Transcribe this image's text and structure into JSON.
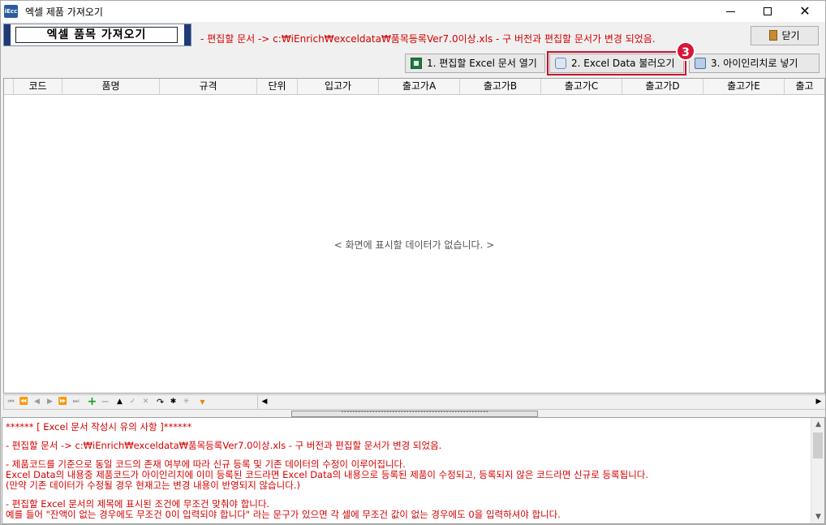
{
  "window": {
    "title": "엑셀 제품 가져오기",
    "app_icon_text": "iEcc",
    "minimize_label": "",
    "maximize_label": "",
    "close_glyph": "✕"
  },
  "header": {
    "heading": "엑셀 품목 가져오기",
    "note": "- 편집할 문서 -> c:₩iEnrich₩exceldata₩품목등록Ver7.0이상.xls - 구 버전과 편집할 문서가 변경 되었음.",
    "close_button": "닫기"
  },
  "toolbar": {
    "buttons": [
      {
        "label": "1. 편집할 Excel 문서 열기",
        "icon": "excel-icon"
      },
      {
        "label": "2. Excel Data 불러오기",
        "icon": "import-data-icon"
      },
      {
        "label": "3. 아이인리치로 넣기",
        "icon": "database-insert-icon"
      }
    ],
    "badge": "3",
    "highlight_color": "#c8102e"
  },
  "grid": {
    "columns": [
      "코드",
      "품명",
      "규격",
      "단위",
      "입고가",
      "출고가A",
      "출고가B",
      "출고가C",
      "출고가D",
      "출고가E",
      "출고"
    ],
    "empty_message": "< 화면에 표시할 데이터가 없습니다. >"
  },
  "navigator": {
    "buttons": [
      "⏮",
      "⏪",
      "◀",
      "▶",
      "⏩",
      "⏭",
      "+",
      "−",
      "▲",
      "✓",
      "✕",
      "↷",
      "✱",
      "✳",
      "▼"
    ],
    "scroll_left": "◀",
    "scroll_right": "▶",
    "splitter": "˅˅˅˅˅˅˅˅˅˅˅˅˅˅˅˅˅˅˅˅˅˅˅˅˅˅˅˅˅˅˅˅˅˅˅˅˅˅˅˅˅˅˅˅˅˅˅˅˅˅˅˅"
  },
  "notes": {
    "lines": [
      "****** [ Excel 문서 작성시 유의 사항 ]******",
      "- 편집할 문서 -> c:₩iEnrich₩exceldata₩품목등록Ver7.0이상.xls - 구 버전과 편집할 문서가 변경 되었음.",
      "- 제품코드를 기준으로 동일 코드의 존재 여부에 따라 신규 등록 및 기존 데이터의 수정이 이루어집니다.",
      " Excel Data의 내용중 제품코드가 아이인리치에 이미 등록된 코드라면 Excel Data의 내용으로 등록된 제품이 수정되고,  등록되지 않은 코드라면 신규로 등록됩니다.",
      "(만약 기존 데이터가 수정될 경우 현재고는 변경 내용이 반영되지 않습니다.)",
      "- 편집할 Excel 문서의 제목에 표시된 조건에 무조건 맞춰야 합니다.",
      "예를 들어 \"잔액이 없는 경우에도 무조건 0이 입력되야 합니다\" 라는 문구가 있으면 각 셀에 무조건 값이 없는 경우에도 0을 입력하셔야 합니다."
    ],
    "scroll_up": "▲",
    "scroll_down": "▼"
  },
  "colors": {
    "warning_text": "#d40000",
    "heading_bar": "#1f3a78",
    "badge": "#d7173a"
  }
}
